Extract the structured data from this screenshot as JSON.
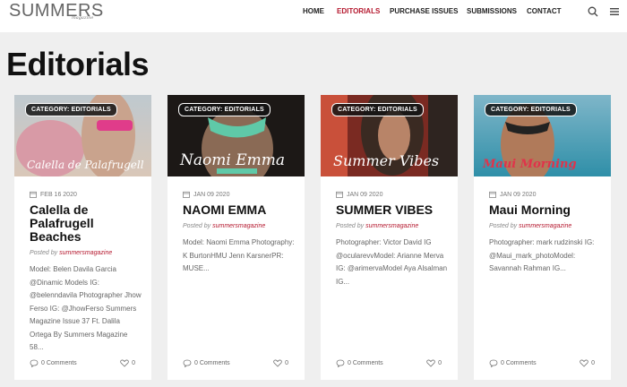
{
  "header": {
    "logo": "SUMMERS",
    "logo_sub": "magazine",
    "nav": [
      {
        "label": "HOME",
        "active": false
      },
      {
        "label": "EDITORIALS",
        "active": true
      },
      {
        "label": "PURCHASE ISSUES",
        "active": false
      },
      {
        "label": "SUBMISSIONS",
        "active": false
      },
      {
        "label": "CONTACT",
        "active": false
      }
    ],
    "icons": [
      "search-icon",
      "menu-icon"
    ]
  },
  "page": {
    "title": "Editorials"
  },
  "cards": [
    {
      "badge": "CATEGORY: EDITORIALS",
      "image_caption": "Calella de Palafrugell",
      "date": "FEB 16 2020",
      "title": "Calella de Palafrugell Beaches",
      "posted_prefix": "Posted by",
      "author": "summersmagazine",
      "excerpt": "Model: Belen Davila Garcia @Dinamic Models IG: @belenndavila Photographer Jhow Ferso IG: @JhowFerso Summers Magazine Issue 37 Ft. Dalila Ortega By Summers Magazine 58...",
      "comments": "0 Comments",
      "likes": "0"
    },
    {
      "badge": "CATEGORY: EDITORIALS",
      "image_caption": "Naomi Emma",
      "date": "JAN 09 2020",
      "title": "NAOMI EMMA",
      "posted_prefix": "Posted by",
      "author": "summersmagazine",
      "excerpt": "Model: Naomi Emma Photography: K BurtonHMU Jenn KarsnerPR: MUSE...",
      "comments": "0 Comments",
      "likes": "0"
    },
    {
      "badge": "CATEGORY: EDITORIALS",
      "image_caption": "Summer Vibes",
      "date": "JAN 09 2020",
      "title": "SUMMER VIBES",
      "posted_prefix": "Posted by",
      "author": "summersmagazine",
      "excerpt": "Photographer: Victor David IG @ocularevvModel: Arianne Merva IG: @arimervaModel Aya Alsalman IG...",
      "comments": "0 Comments",
      "likes": "0"
    },
    {
      "badge": "CATEGORY: EDITORIALS",
      "image_caption": "Maui Morning",
      "date": "JAN 09 2020",
      "title": "Maui Morning",
      "posted_prefix": "Posted by",
      "author": "summersmagazine",
      "excerpt": "Photographer: mark rudzinski IG: @Maui_mark_photoModel: Savannah Rahman IG...",
      "comments": "0 Comments",
      "likes": "0"
    }
  ],
  "colors": {
    "accent": "#b5192f",
    "background": "#efefef"
  }
}
